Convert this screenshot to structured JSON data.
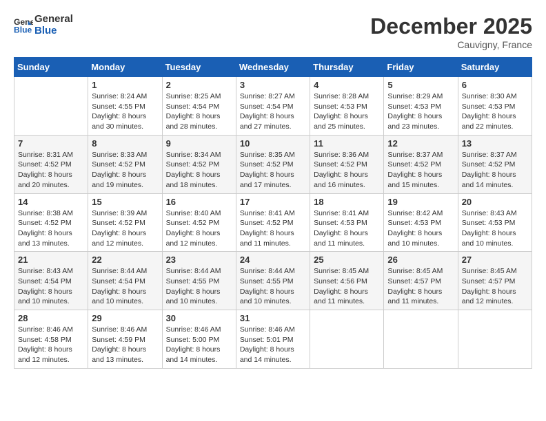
{
  "header": {
    "logo_line1": "General",
    "logo_line2": "Blue",
    "month_title": "December 2025",
    "location": "Cauvigny, France"
  },
  "days_of_week": [
    "Sunday",
    "Monday",
    "Tuesday",
    "Wednesday",
    "Thursday",
    "Friday",
    "Saturday"
  ],
  "weeks": [
    [
      {
        "day": "",
        "info": ""
      },
      {
        "day": "1",
        "info": "Sunrise: 8:24 AM\nSunset: 4:55 PM\nDaylight: 8 hours\nand 30 minutes."
      },
      {
        "day": "2",
        "info": "Sunrise: 8:25 AM\nSunset: 4:54 PM\nDaylight: 8 hours\nand 28 minutes."
      },
      {
        "day": "3",
        "info": "Sunrise: 8:27 AM\nSunset: 4:54 PM\nDaylight: 8 hours\nand 27 minutes."
      },
      {
        "day": "4",
        "info": "Sunrise: 8:28 AM\nSunset: 4:53 PM\nDaylight: 8 hours\nand 25 minutes."
      },
      {
        "day": "5",
        "info": "Sunrise: 8:29 AM\nSunset: 4:53 PM\nDaylight: 8 hours\nand 23 minutes."
      },
      {
        "day": "6",
        "info": "Sunrise: 8:30 AM\nSunset: 4:53 PM\nDaylight: 8 hours\nand 22 minutes."
      }
    ],
    [
      {
        "day": "7",
        "info": "Sunrise: 8:31 AM\nSunset: 4:52 PM\nDaylight: 8 hours\nand 20 minutes."
      },
      {
        "day": "8",
        "info": "Sunrise: 8:33 AM\nSunset: 4:52 PM\nDaylight: 8 hours\nand 19 minutes."
      },
      {
        "day": "9",
        "info": "Sunrise: 8:34 AM\nSunset: 4:52 PM\nDaylight: 8 hours\nand 18 minutes."
      },
      {
        "day": "10",
        "info": "Sunrise: 8:35 AM\nSunset: 4:52 PM\nDaylight: 8 hours\nand 17 minutes."
      },
      {
        "day": "11",
        "info": "Sunrise: 8:36 AM\nSunset: 4:52 PM\nDaylight: 8 hours\nand 16 minutes."
      },
      {
        "day": "12",
        "info": "Sunrise: 8:37 AM\nSunset: 4:52 PM\nDaylight: 8 hours\nand 15 minutes."
      },
      {
        "day": "13",
        "info": "Sunrise: 8:37 AM\nSunset: 4:52 PM\nDaylight: 8 hours\nand 14 minutes."
      }
    ],
    [
      {
        "day": "14",
        "info": "Sunrise: 8:38 AM\nSunset: 4:52 PM\nDaylight: 8 hours\nand 13 minutes."
      },
      {
        "day": "15",
        "info": "Sunrise: 8:39 AM\nSunset: 4:52 PM\nDaylight: 8 hours\nand 12 minutes."
      },
      {
        "day": "16",
        "info": "Sunrise: 8:40 AM\nSunset: 4:52 PM\nDaylight: 8 hours\nand 12 minutes."
      },
      {
        "day": "17",
        "info": "Sunrise: 8:41 AM\nSunset: 4:52 PM\nDaylight: 8 hours\nand 11 minutes."
      },
      {
        "day": "18",
        "info": "Sunrise: 8:41 AM\nSunset: 4:53 PM\nDaylight: 8 hours\nand 11 minutes."
      },
      {
        "day": "19",
        "info": "Sunrise: 8:42 AM\nSunset: 4:53 PM\nDaylight: 8 hours\nand 10 minutes."
      },
      {
        "day": "20",
        "info": "Sunrise: 8:43 AM\nSunset: 4:53 PM\nDaylight: 8 hours\nand 10 minutes."
      }
    ],
    [
      {
        "day": "21",
        "info": "Sunrise: 8:43 AM\nSunset: 4:54 PM\nDaylight: 8 hours\nand 10 minutes."
      },
      {
        "day": "22",
        "info": "Sunrise: 8:44 AM\nSunset: 4:54 PM\nDaylight: 8 hours\nand 10 minutes."
      },
      {
        "day": "23",
        "info": "Sunrise: 8:44 AM\nSunset: 4:55 PM\nDaylight: 8 hours\nand 10 minutes."
      },
      {
        "day": "24",
        "info": "Sunrise: 8:44 AM\nSunset: 4:55 PM\nDaylight: 8 hours\nand 10 minutes."
      },
      {
        "day": "25",
        "info": "Sunrise: 8:45 AM\nSunset: 4:56 PM\nDaylight: 8 hours\nand 11 minutes."
      },
      {
        "day": "26",
        "info": "Sunrise: 8:45 AM\nSunset: 4:57 PM\nDaylight: 8 hours\nand 11 minutes."
      },
      {
        "day": "27",
        "info": "Sunrise: 8:45 AM\nSunset: 4:57 PM\nDaylight: 8 hours\nand 12 minutes."
      }
    ],
    [
      {
        "day": "28",
        "info": "Sunrise: 8:46 AM\nSunset: 4:58 PM\nDaylight: 8 hours\nand 12 minutes."
      },
      {
        "day": "29",
        "info": "Sunrise: 8:46 AM\nSunset: 4:59 PM\nDaylight: 8 hours\nand 13 minutes."
      },
      {
        "day": "30",
        "info": "Sunrise: 8:46 AM\nSunset: 5:00 PM\nDaylight: 8 hours\nand 14 minutes."
      },
      {
        "day": "31",
        "info": "Sunrise: 8:46 AM\nSunset: 5:01 PM\nDaylight: 8 hours\nand 14 minutes."
      },
      {
        "day": "",
        "info": ""
      },
      {
        "day": "",
        "info": ""
      },
      {
        "day": "",
        "info": ""
      }
    ]
  ]
}
